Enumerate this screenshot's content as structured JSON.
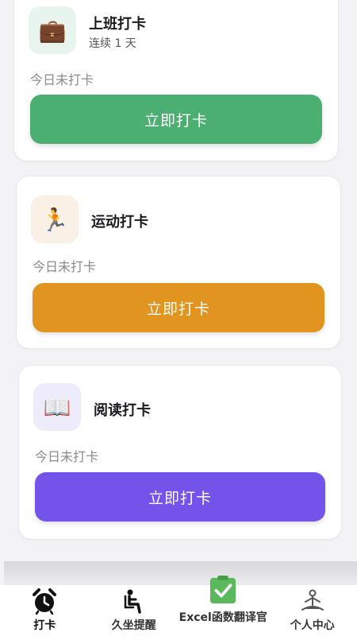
{
  "cards": [
    {
      "title": "上班打卡",
      "subtitle": "连续 1 天",
      "icon_emoji": "💼",
      "icon_name": "briefcase-icon",
      "icon_bg": "#e8f4ee",
      "status": "今日未打卡",
      "button_label": "立即打卡",
      "button_color": "#4caf72"
    },
    {
      "title": "运动打卡",
      "subtitle": "",
      "icon_emoji": "🏃",
      "icon_name": "running-icon",
      "icon_bg": "#fbf0e5",
      "status": "今日未打卡",
      "button_label": "立即打卡",
      "button_color": "#e1941f"
    },
    {
      "title": "阅读打卡",
      "subtitle": "",
      "icon_emoji": "📖",
      "icon_name": "book-icon",
      "icon_bg": "#eeecfb",
      "status": "今日未打卡",
      "button_label": "立即打卡",
      "button_color": "#7353ea"
    }
  ],
  "tabbar": {
    "tabs": [
      {
        "label": "打卡",
        "icon": "alarm-clock-icon",
        "active": true
      },
      {
        "label": "久坐提醒",
        "icon": "sitting-person-icon",
        "active": false
      },
      {
        "label": "Excel函数翻译官",
        "icon": "checklist-icon",
        "active": false
      },
      {
        "label": "个人中心",
        "icon": "meditation-person-icon",
        "active": false
      }
    ]
  }
}
